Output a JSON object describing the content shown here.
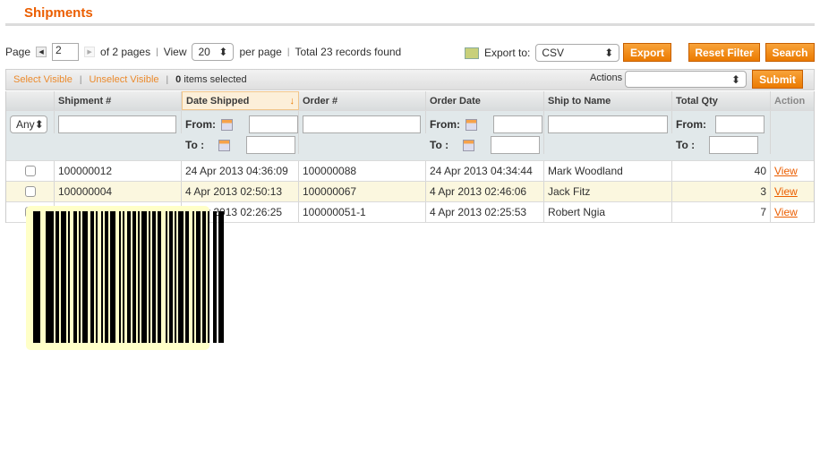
{
  "title": "Shipments",
  "pager": {
    "page_label": "Page",
    "page_value": "2",
    "of_pages": "of 2 pages",
    "view_label": "View",
    "per_page_value": "20",
    "per_page_label": "per page",
    "total": "Total 23 records found"
  },
  "export": {
    "label": "Export to:",
    "format": "CSV",
    "export_button": "Export"
  },
  "buttons": {
    "reset_filter": "Reset Filter",
    "search": "Search",
    "submit": "Submit"
  },
  "massaction": {
    "select_visible": "Select Visible",
    "unselect_visible": "Unselect Visible",
    "count": "0",
    "items_selected": "items selected",
    "actions_label": "Actions",
    "actions_value": ""
  },
  "columns": [
    "",
    "Shipment #",
    "Date Shipped",
    "Order #",
    "Order Date",
    "Ship to Name",
    "Total Qty",
    "Action"
  ],
  "filters": {
    "any": "Any",
    "from": "From:",
    "to": "To :"
  },
  "rows": [
    {
      "shipment": "100000012",
      "date_shipped": "24 Apr 2013 04:36:09",
      "order": "100000088",
      "order_date": "24 Apr 2013 04:34:44",
      "ship_to": "Mark Woodland",
      "qty": "40",
      "action": "View"
    },
    {
      "shipment": "100000004",
      "date_shipped": "4 Apr 2013 02:50:13",
      "order": "100000067",
      "order_date": "4 Apr 2013 02:46:06",
      "ship_to": "Jack Fitz",
      "qty": "3",
      "action": "View"
    },
    {
      "shipment": "",
      "date_shipped": "4 Apr 2013 02:26:25",
      "order": "100000051-1",
      "order_date": "4 Apr 2013 02:25:53",
      "ship_to": "Robert Ngia",
      "qty": "7",
      "action": "View"
    }
  ],
  "colors": {
    "accent": "#eb5e00",
    "row_highlight": "#fbf7df",
    "tooltip_bg": "#ffffc8"
  }
}
